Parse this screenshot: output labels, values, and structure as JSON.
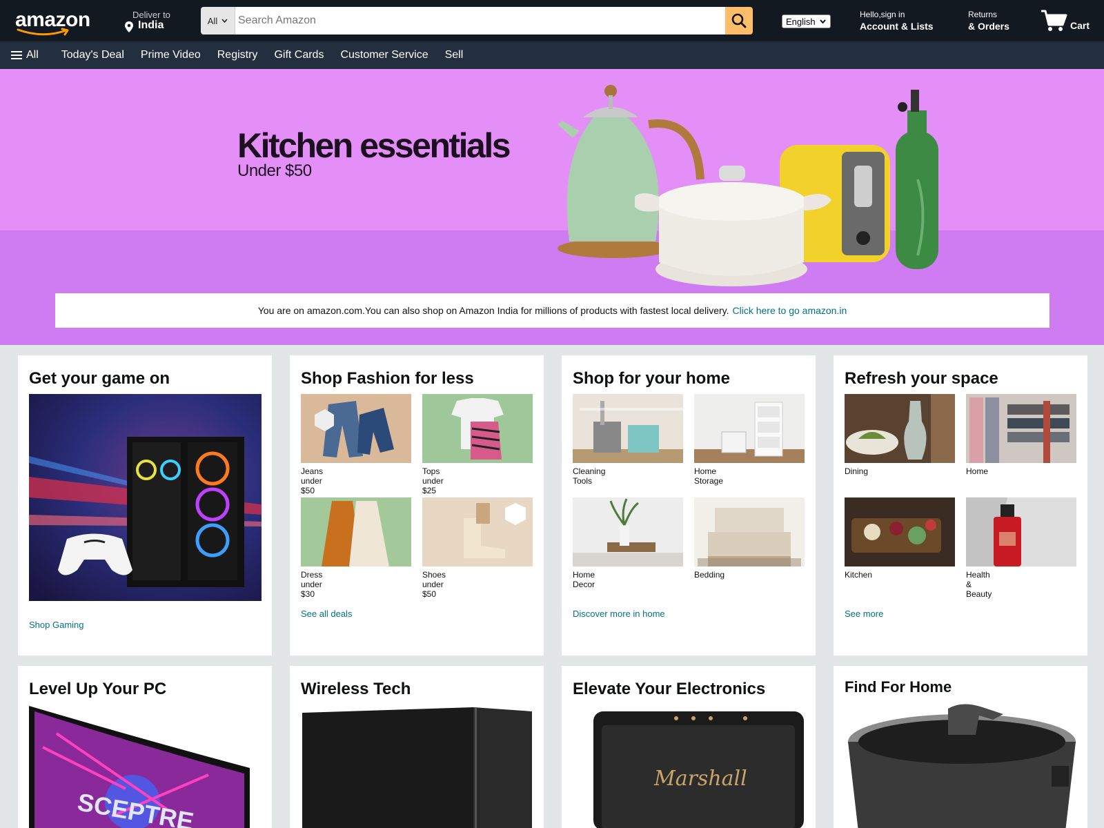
{
  "nav": {
    "logo_text": "amazon",
    "deliver_line1": "Deliver to",
    "deliver_line2": "India",
    "search_category": "All",
    "search_placeholder": "Search Amazon",
    "language": "English",
    "account_line1": "Hello,sign in",
    "account_line2": "Account & Lists",
    "returns_line1": "Returns",
    "returns_line2": "& Orders",
    "cart_label": "Cart"
  },
  "subnav": {
    "all_label": "All",
    "items": [
      "Today's Deal",
      "Prime Video",
      "Registry",
      "Gift Cards",
      "Customer Service",
      "Sell"
    ]
  },
  "hero": {
    "title": "Kitchen essentials",
    "subtitle": "Under $50"
  },
  "notice": {
    "text": "You are on amazon.com.You can also shop on Amazon India for millions of products with fastest local delivery.",
    "link": "Click here to go amazon.in"
  },
  "cards": {
    "gaming": {
      "title": "Get your game on",
      "link": "Shop Gaming"
    },
    "fashion": {
      "title": "Shop Fashion for less",
      "items": [
        "Jeans under $50",
        "Tops under $25",
        "Dress under $30",
        "Shoes under $50"
      ],
      "link": "See all deals"
    },
    "home": {
      "title": "Shop for your home",
      "items": [
        "Cleaning Tools",
        "Home Storage",
        "Home Decor",
        "Bedding"
      ],
      "link": "Discover more in home"
    },
    "refresh": {
      "title": "Refresh your space",
      "items": [
        "Dining",
        "Home",
        "Kitchen",
        "Health & Beauty"
      ],
      "link": "See more"
    },
    "pc": {
      "title": "Level Up Your PC",
      "brand": "SCEPTRE"
    },
    "wireless": {
      "title": "Wireless Tech"
    },
    "electronics": {
      "title": "Elevate Your Electronics",
      "brand": "Marshall"
    },
    "findhome": {
      "title": "Find For Home"
    }
  },
  "colors": {
    "nav_bg": "#131921",
    "subnav_bg": "#232f3e",
    "hero_bg": "#e48ef7",
    "search_button": "#febd69",
    "link": "#007185",
    "page_bg": "#e3e6e6"
  }
}
